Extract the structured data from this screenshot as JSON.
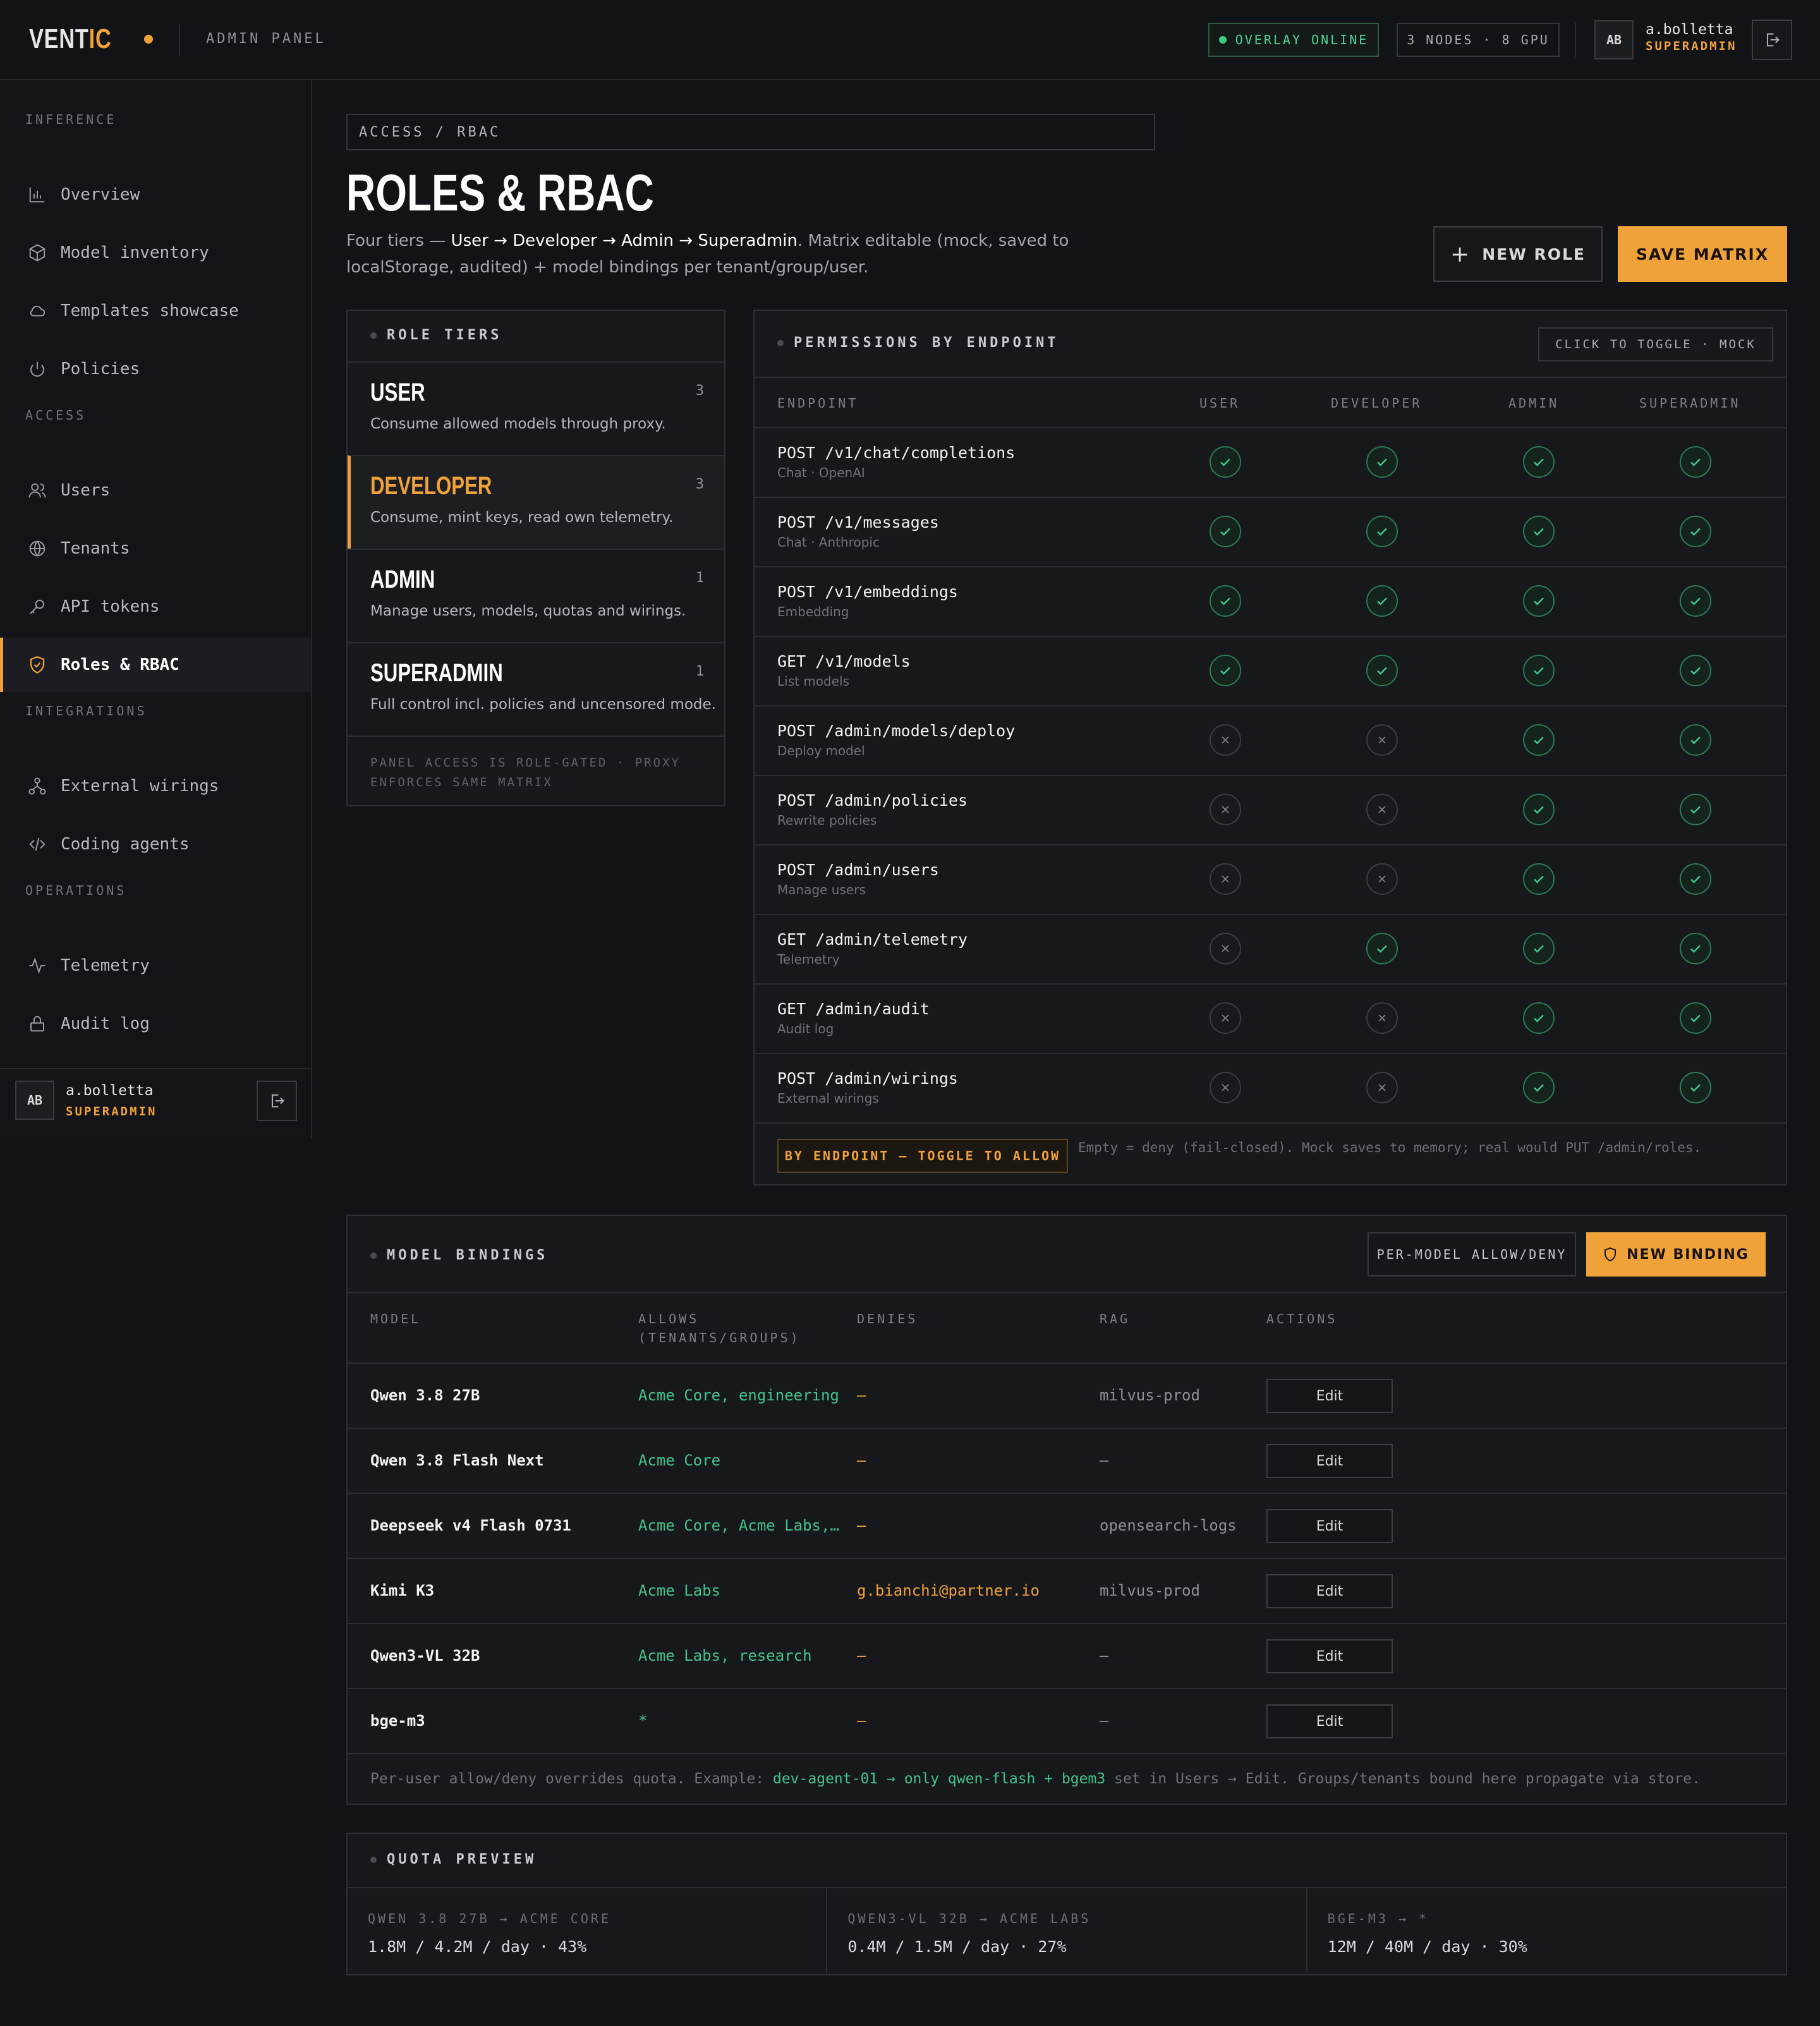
{
  "topbar": {
    "logo_a": "VENT",
    "logo_b": "IC",
    "section": "ADMIN PANEL",
    "status": "OVERLAY ONLINE",
    "nodes": "3 NODES · 8 GPU",
    "avatar": "AB",
    "user": "a.bolletta",
    "role": "SUPERADMIN"
  },
  "sidebar": {
    "sections": [
      "INFERENCE",
      "ACCESS",
      "INTEGRATIONS",
      "OPERATIONS"
    ],
    "items": [
      {
        "label": "Overview",
        "icon": "chart-bar-icon"
      },
      {
        "label": "Model inventory",
        "icon": "cube-icon"
      },
      {
        "label": "Templates showcase",
        "icon": "cloud-icon"
      },
      {
        "label": "Policies",
        "icon": "power-icon"
      },
      {
        "label": "Users",
        "icon": "users-icon"
      },
      {
        "label": "Tenants",
        "icon": "globe-icon"
      },
      {
        "label": "API tokens",
        "icon": "key-icon"
      },
      {
        "label": "Roles & RBAC",
        "icon": "shield-check-icon",
        "active": true
      },
      {
        "label": "External wirings",
        "icon": "network-icon"
      },
      {
        "label": "Coding agents",
        "icon": "code-icon"
      },
      {
        "label": "Telemetry",
        "icon": "activity-icon"
      },
      {
        "label": "Audit log",
        "icon": "lock-icon"
      }
    ],
    "footer": {
      "avatar": "AB",
      "user": "a.bolletta",
      "role": "SUPERADMIN"
    }
  },
  "page": {
    "breadcrumb": "ACCESS / RBAC",
    "title": "ROLES & RBAC",
    "desc_pre": "Four tiers — ",
    "desc_chain": "User → Developer → Admin → Superadmin",
    "desc_post": ". Matrix editable (mock, saved to localStorage, audited) + model bindings per tenant/group/user.",
    "new_role": "NEW ROLE",
    "save_matrix": "SAVE MATRIX"
  },
  "tiers": {
    "title": "ROLE TIERS",
    "items": [
      {
        "name": "USER",
        "count": "3",
        "desc": "Consume allowed models through proxy."
      },
      {
        "name": "DEVELOPER",
        "count": "3",
        "desc": "Consume, mint keys, read own telemetry.",
        "selected": true
      },
      {
        "name": "ADMIN",
        "count": "1",
        "desc": "Manage users, models, quotas and wirings."
      },
      {
        "name": "SUPERADMIN",
        "count": "1",
        "desc": "Full control incl. policies and uncensored mode."
      }
    ],
    "footer": "PANEL ACCESS IS ROLE-GATED · PROXY ENFORCES SAME MATRIX"
  },
  "permissions": {
    "title": "PERMISSIONS BY ENDPOINT",
    "toggle_hint": "CLICK TO TOGGLE · MOCK",
    "columns": [
      "ENDPOINT",
      "USER",
      "DEVELOPER",
      "ADMIN",
      "SUPERADMIN"
    ],
    "rows": [
      {
        "endpoint": "POST /v1/chat/completions",
        "sub": "Chat · OpenAI",
        "allow": [
          true,
          true,
          true,
          true
        ]
      },
      {
        "endpoint": "POST /v1/messages",
        "sub": "Chat · Anthropic",
        "allow": [
          true,
          true,
          true,
          true
        ]
      },
      {
        "endpoint": "POST /v1/embeddings",
        "sub": "Embedding",
        "allow": [
          true,
          true,
          true,
          true
        ]
      },
      {
        "endpoint": "GET /v1/models",
        "sub": "List models",
        "allow": [
          true,
          true,
          true,
          true
        ]
      },
      {
        "endpoint": "POST /admin/models/deploy",
        "sub": "Deploy model",
        "allow": [
          false,
          false,
          true,
          true
        ]
      },
      {
        "endpoint": "POST /admin/policies",
        "sub": "Rewrite policies",
        "allow": [
          false,
          false,
          true,
          true
        ]
      },
      {
        "endpoint": "POST /admin/users",
        "sub": "Manage users",
        "allow": [
          false,
          false,
          true,
          true
        ]
      },
      {
        "endpoint": "GET /admin/telemetry",
        "sub": "Telemetry",
        "allow": [
          false,
          true,
          true,
          true
        ]
      },
      {
        "endpoint": "GET /admin/audit",
        "sub": "Audit log",
        "allow": [
          false,
          false,
          true,
          true
        ]
      },
      {
        "endpoint": "POST /admin/wirings",
        "sub": "External wirings",
        "allow": [
          false,
          false,
          true,
          true
        ]
      }
    ],
    "footer_chip": "BY ENDPOINT — TOGGLE TO ALLOW",
    "footer_note": "Empty = deny (fail-closed). Mock saves to memory; real would PUT /admin/roles."
  },
  "bindings": {
    "title": "MODEL BINDINGS",
    "per_model": "PER-MODEL ALLOW/DENY",
    "new_binding": "NEW BINDING",
    "columns": {
      "model": "MODEL",
      "allows_1": "ALLOWS",
      "allows_2": "(TENANTS/GROUPS)",
      "denies": "DENIES",
      "rag": "RAG",
      "actions": "ACTIONS"
    },
    "rows": [
      {
        "model": "Qwen 3.8 27B",
        "allows": "Acme Core, engineering",
        "denies": "—",
        "rag": "milvus-prod",
        "action": "Edit"
      },
      {
        "model": "Qwen 3.8 Flash Next",
        "allows": "Acme Core",
        "denies": "—",
        "rag": "—",
        "action": "Edit"
      },
      {
        "model": "Deepseek v4 Flash 0731",
        "allows": "Acme Core, Acme Labs, r…",
        "denies": "—",
        "rag": "opensearch-logs",
        "action": "Edit"
      },
      {
        "model": "Kimi K3",
        "allows": "Acme Labs",
        "denies": "g.bianchi@partner.io",
        "rag": "milvus-prod",
        "action": "Edit"
      },
      {
        "model": "Qwen3-VL 32B",
        "allows": "Acme Labs, research",
        "denies": "—",
        "rag": "—",
        "action": "Edit"
      },
      {
        "model": "bge-m3",
        "allows": "*",
        "denies": "—",
        "rag": "—",
        "action": "Edit"
      }
    ],
    "note_pre": "Per-user allow/deny overrides quota. Example: ",
    "note_hl": "dev-agent-01 → only qwen-flash + bgem3",
    "note_post": " set in Users → Edit. Groups/tenants bound here propagate via store."
  },
  "quota": {
    "title": "QUOTA PREVIEW",
    "items": [
      {
        "label": "QWEN 3.8 27B → ACME CORE",
        "value": "1.8M / 4.2M / day · 43%"
      },
      {
        "label": "QWEN3-VL 32B → ACME LABS",
        "value": "0.4M / 1.5M / day · 27%"
      },
      {
        "label": "BGE-M3 → *",
        "value": "12M / 40M / day · 30%"
      }
    ]
  },
  "colors": {
    "accent": "#f0a23a",
    "ok": "#3ecb8a",
    "bg": "#121316"
  }
}
